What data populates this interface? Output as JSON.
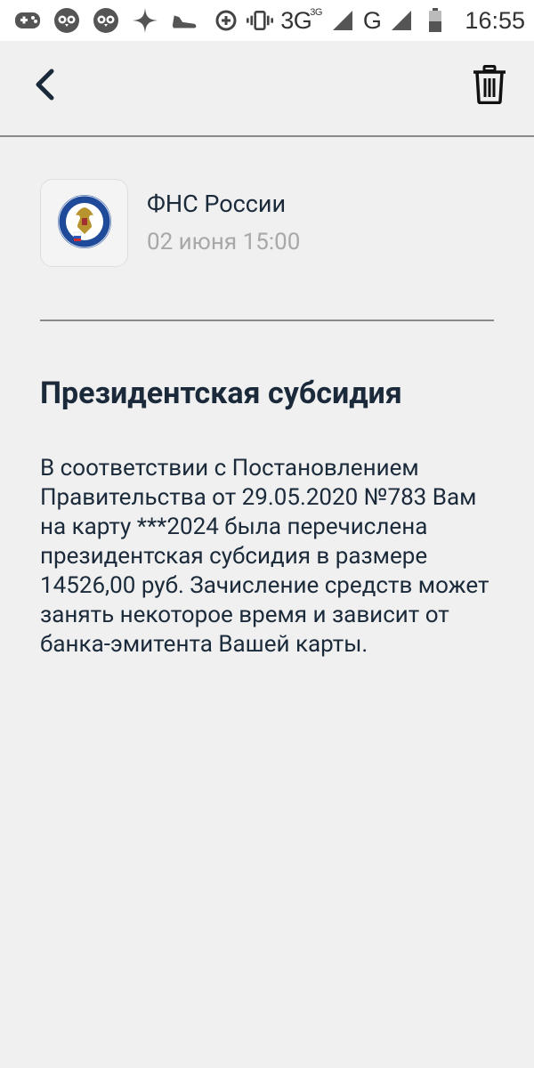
{
  "status_bar": {
    "network_3g": "3G",
    "network_3g_sup": "3G",
    "network_g": "G",
    "time": "16:55",
    "icons": [
      "gamepad-icon",
      "owl-icon",
      "owl-icon",
      "sparkle-icon",
      "sneaker-icon",
      "data-saver-icon",
      "vibrate-icon",
      "signal-icon",
      "signal-icon",
      "battery-icon"
    ]
  },
  "header": {
    "back_icon": "chevron-left-icon",
    "delete_icon": "trash-icon"
  },
  "message": {
    "sender_name": "ФНС России",
    "date": "02 июня 15:00",
    "logo_icon": "fns-emblem-icon",
    "title": "Президентская субсидия",
    "body": "В соответствии с Постановлением Правительства от 29.05.2020 №783 Вам на карту ***2024 была перечислена президентская субсидия в размере 14526,00 руб. Зачисление средств может занять некоторое время и зависит от банка-эмитента Вашей карты."
  },
  "colors": {
    "background": "#f0f0f0",
    "text_primary": "#1b2a3a",
    "text_secondary": "#a8a8a8",
    "divider": "#8a8a8a"
  }
}
